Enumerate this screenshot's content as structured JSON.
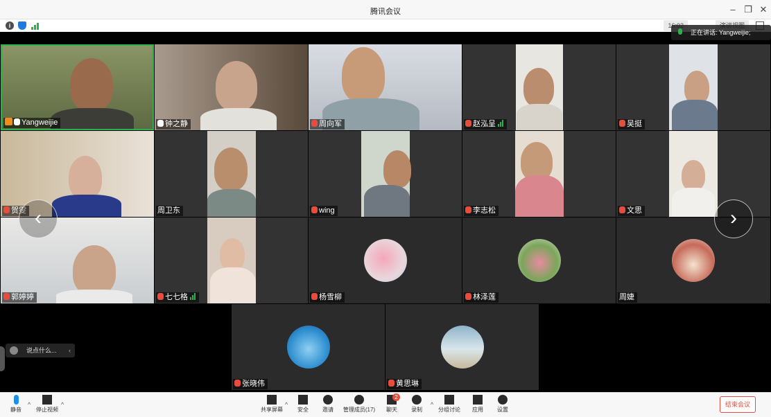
{
  "window": {
    "title": "腾讯会议"
  },
  "status": {
    "time": "16:02",
    "view_label": "演讲视图"
  },
  "speaking": {
    "label": "正在讲话: Yangweijie;"
  },
  "participants": [
    {
      "name": "Yangweijie",
      "mic": "on",
      "host": true,
      "active": true
    },
    {
      "name": "钟之静",
      "mic": "on"
    },
    {
      "name": "周向军",
      "mic": "off"
    },
    {
      "name": "赵泓呈",
      "mic": "off",
      "signal": true
    },
    {
      "name": "吴挺",
      "mic": "off"
    },
    {
      "name": "贺雯",
      "mic": "off"
    },
    {
      "name": "周卫东",
      "mic": "none"
    },
    {
      "name": "wing",
      "mic": "off"
    },
    {
      "name": "李志松",
      "mic": "off"
    },
    {
      "name": "文思",
      "mic": "off"
    },
    {
      "name": "郭婷婷",
      "mic": "off"
    },
    {
      "name": "七七格",
      "mic": "off",
      "signal": true
    },
    {
      "name": "杨雪柳",
      "mic": "off"
    },
    {
      "name": "林泽莲",
      "mic": "off"
    },
    {
      "name": "周婕",
      "mic": "none"
    },
    {
      "name": "张晓伟",
      "mic": "off"
    },
    {
      "name": "黄思琳",
      "mic": "off"
    }
  ],
  "chat": {
    "placeholder": "说点什么..."
  },
  "toolbar": {
    "mute": "静音",
    "stop_video": "停止视频",
    "share_screen": "共享屏幕",
    "security": "安全",
    "invite": "邀请",
    "manage_members": "管理成员(17)",
    "chat": "聊天",
    "chat_badge": "2",
    "record": "录制",
    "breakout": "分组讨论",
    "apps": "应用",
    "settings": "设置",
    "end_meeting": "结束会议"
  },
  "icons": [
    "info-icon",
    "shield-icon",
    "signal-icon",
    "fullscreen-icon",
    "mic-icon",
    "camera-icon",
    "share-screen-icon",
    "security-icon",
    "invite-icon",
    "members-icon",
    "chat-icon",
    "record-icon",
    "breakout-icon",
    "apps-icon",
    "settings-icon",
    "arrow-left-icon",
    "arrow-right-icon",
    "smile-icon"
  ],
  "colors": {
    "accent_green": "#2bb24c",
    "mic_blue": "#1d8fe8",
    "end_red": "#e74c3c"
  }
}
